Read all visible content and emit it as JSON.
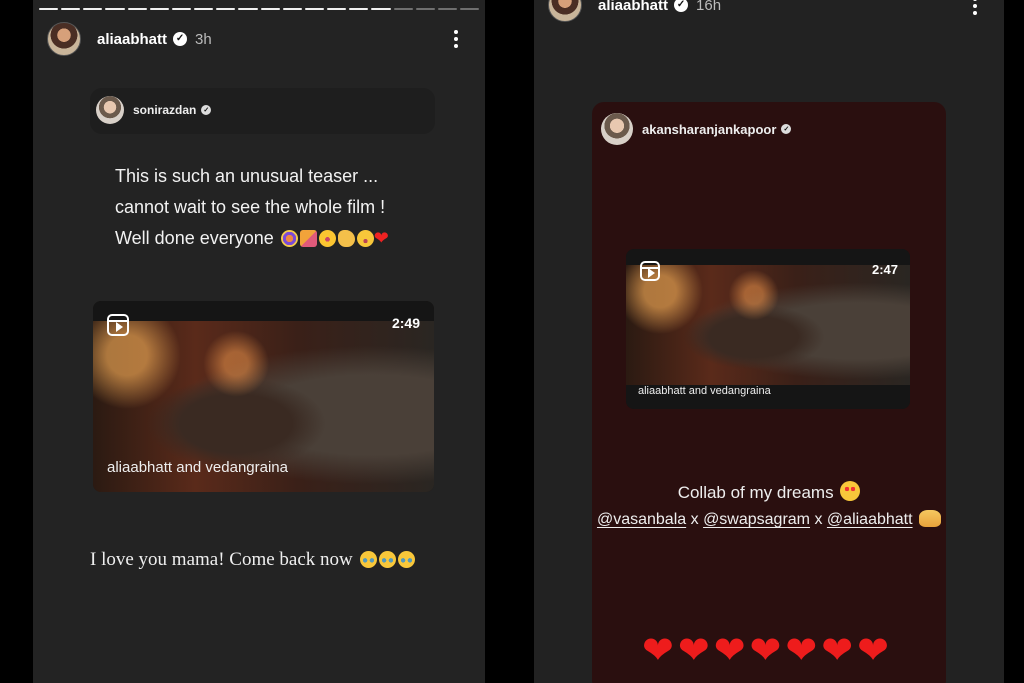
{
  "left_story": {
    "author": "aliaabhatt",
    "time": "3h",
    "shared_post": {
      "author": "sonirazdan",
      "caption_lines": [
        "This is such an unusual teaser ...",
        "cannot wait to see the whole film !",
        "Well done everyone"
      ],
      "caption_emojis": [
        "confetti-ball",
        "party-popper",
        "star-struck",
        "clapping-hands",
        "partying-face",
        "red-heart"
      ],
      "reel": {
        "duration": "2:49",
        "label": "aliaabhatt and vedangraina"
      }
    },
    "bottom_text": "I love you mama! Come back now",
    "bottom_emojis": [
      "loudly-crying-face",
      "loudly-crying-face",
      "loudly-crying-face"
    ]
  },
  "right_story": {
    "author": "aliaabhatt",
    "time": "16h",
    "shared_post": {
      "author": "akansharanjankapoor",
      "reel": {
        "duration": "2:47",
        "label": "aliaabhatt and vedangraina"
      },
      "collab_text": "Collab of my dreams",
      "collab_emoji": "smiling-face-with-heart-eyes",
      "mentions": [
        "@vasanbala",
        "@swapsagram",
        "@aliaabhatt"
      ],
      "separator": "x",
      "mentions_emoji": "raising-hands",
      "hearts_count": 7
    }
  },
  "colors": {
    "left_bg": "#232323",
    "right_card_bg": "#2a0f0f",
    "heart": "#ee1c1c"
  }
}
